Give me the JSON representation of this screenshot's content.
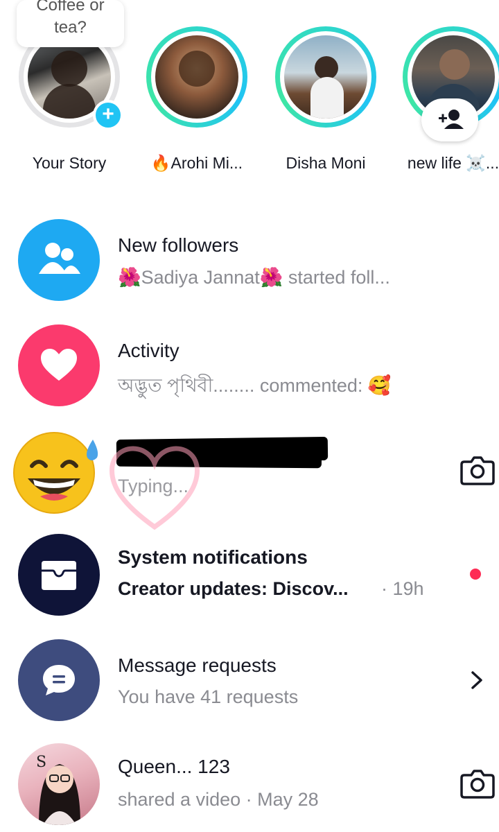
{
  "stories": [
    {
      "name": "Your Story",
      "bubble": [
        "Coffee or",
        "tea?"
      ],
      "badge": "+"
    },
    {
      "name": "🔥Arohi Mi..."
    },
    {
      "name": "Disha Moni"
    },
    {
      "name": "new life ☠️..."
    }
  ],
  "rows": {
    "new_followers": {
      "title": "New followers",
      "subtitle": "🌺Sadiya Jannat🌺 started foll..."
    },
    "activity": {
      "title": "Activity",
      "subtitle": "অদ্ভুত পৃথিবী........ commented: 🥰"
    },
    "chat": {
      "subtitle": "Typing..."
    },
    "system": {
      "title": "System notifications",
      "subtitle": "Creator updates: Discov...",
      "time": "· 19h"
    },
    "requests": {
      "title": "Message requests",
      "subtitle": "You have 41 requests"
    },
    "queen": {
      "title": "Queen... 123",
      "subtitle": "shared a video · May 28"
    }
  },
  "colors": {
    "followers_icon_bg": "#1ea9f2",
    "activity_icon_bg": "#fb3a6d",
    "system_icon_bg": "#0f1438",
    "requests_icon_bg": "#3e4c7e",
    "unread_dot": "#fe2c55",
    "story_ring": "#2fd8c9"
  },
  "icons": {
    "followers": "people-icon",
    "activity": "heart-icon",
    "system": "inbox-icon",
    "requests": "message-icon",
    "camera": "camera-icon",
    "chevron": "chevron-right-icon"
  }
}
